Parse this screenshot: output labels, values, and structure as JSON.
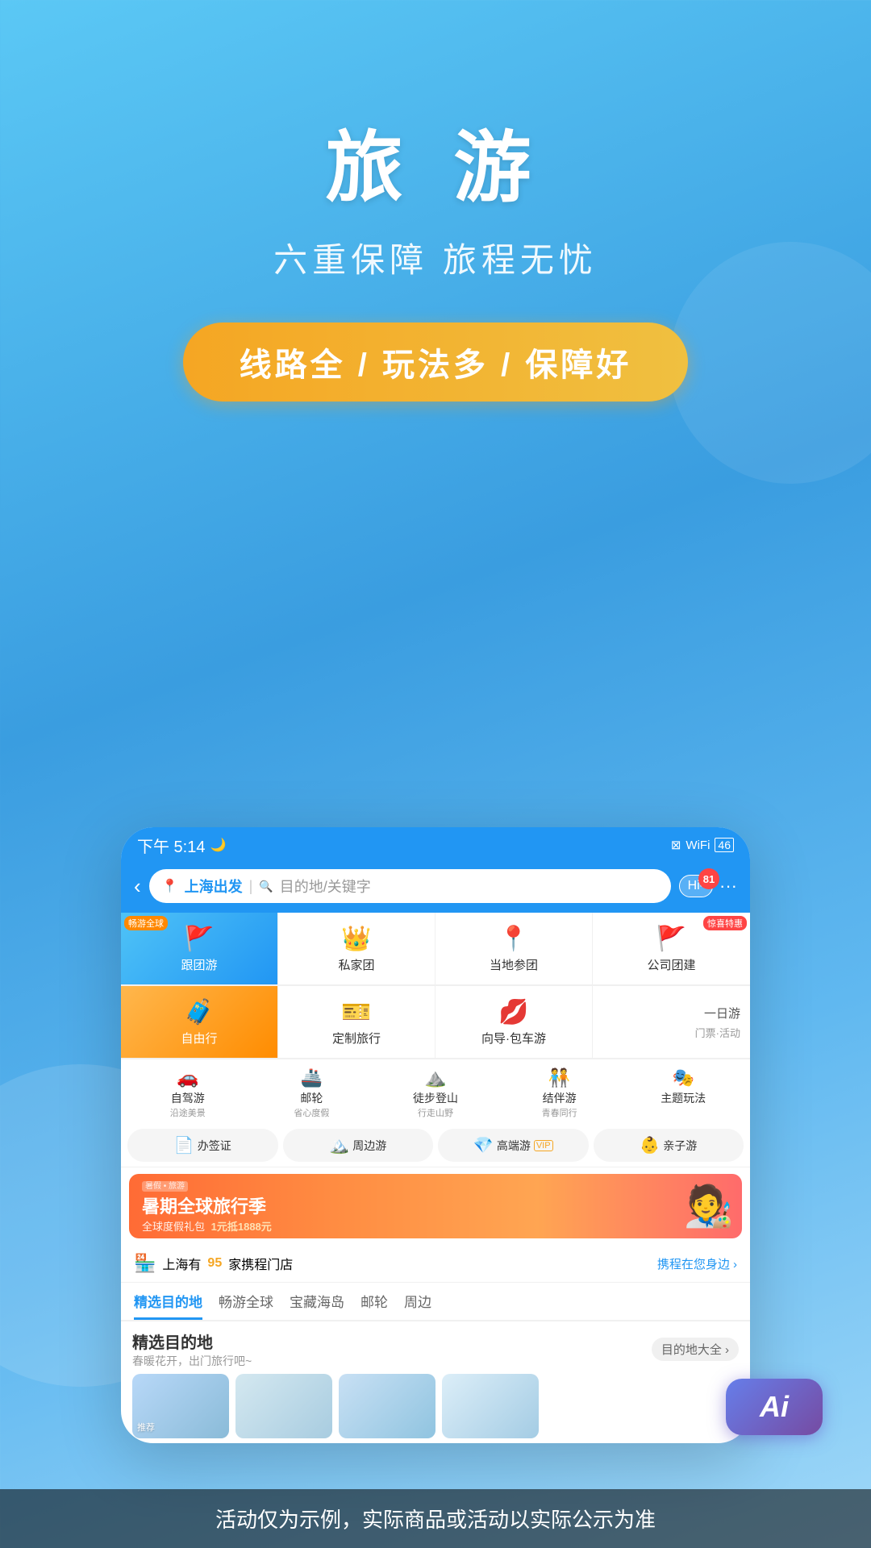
{
  "hero": {
    "title": "旅 游",
    "subtitle": "六重保障 旅程无忧",
    "badge": "线路全 / 玩法多 / 保障好"
  },
  "status_bar": {
    "time": "下午 5:14",
    "moon_icon": "🌙",
    "notification_count": "81"
  },
  "search": {
    "origin": "上海出发",
    "dest_placeholder": "目的地/关键字",
    "hi_label": "Hi-",
    "back_arrow": "‹"
  },
  "grid_row1": [
    {
      "label": "跟团游",
      "badge": "畅游全球",
      "type": "blue"
    },
    {
      "label": "私家团",
      "type": "normal"
    },
    {
      "label": "当地参团",
      "type": "normal"
    },
    {
      "label": "公司团建",
      "badge": "惊喜特惠",
      "type": "normal"
    }
  ],
  "grid_row2": [
    {
      "label": "自由行",
      "type": "orange"
    },
    {
      "label": "定制旅行",
      "type": "normal"
    },
    {
      "label": "向导·包车游",
      "type": "normal"
    },
    {
      "label1": "一日游",
      "label2": "门票·活动",
      "type": "text-right"
    }
  ],
  "small_items": [
    {
      "label": "自驾游",
      "sub": "沿途美景"
    },
    {
      "label": "邮轮",
      "sub": "省心度假"
    },
    {
      "label": "徒步登山",
      "sub": "行走山野"
    },
    {
      "label": "结伴游",
      "sub": "青春同行"
    },
    {
      "label": "主题玩法",
      "sub": ""
    }
  ],
  "quick_links": [
    {
      "label": "办签证"
    },
    {
      "label": "周边游"
    },
    {
      "label": "高端游"
    },
    {
      "label": "亲子游"
    }
  ],
  "banner": {
    "main": "暑期全球旅行季",
    "sub1": "全球度假礼包",
    "sub2": "1元抵1888元"
  },
  "store_row": {
    "prefix": "上海有",
    "count": "95",
    "suffix": "家携程门店",
    "link": "携程在您身边 ›"
  },
  "tabs": [
    {
      "label": "精选目的地",
      "active": true
    },
    {
      "label": "畅游全球"
    },
    {
      "label": "宝藏海岛"
    },
    {
      "label": "邮轮"
    },
    {
      "label": "周边"
    }
  ],
  "dest_section": {
    "title": "精选目的地",
    "subtitle": "春暖花开，出门旅行吧~",
    "link": "目的地大全 ›"
  },
  "disclaimer": "活动仅为示例，实际商品或活动以实际公示为准",
  "ai_button": "Ai"
}
